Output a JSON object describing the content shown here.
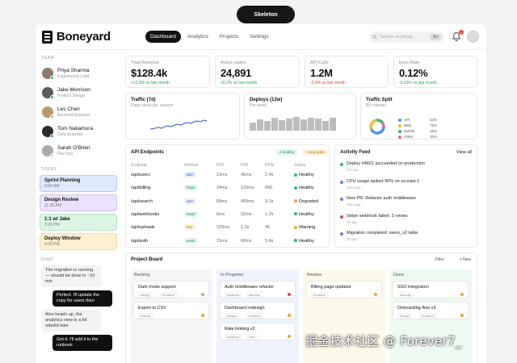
{
  "pill": {
    "label": "Skeleton"
  },
  "header": {
    "logo": "Boneyard",
    "nav": [
      "Dashboard",
      "Analytics",
      "Projects",
      "Settings"
    ],
    "search_placeholder": "Search anything...",
    "search_kbd": "⌘K",
    "notif_count": "3"
  },
  "sidebar": {
    "team_header": "TEAM",
    "team": [
      {
        "name": "Priya Sharma",
        "role": "Engineering Lead",
        "avatar": "#8c7a6b",
        "status": "#2eb872"
      },
      {
        "name": "Jake Morrison",
        "role": "Product Design",
        "avatar": "#5a5a5a",
        "status": "#2eb872"
      },
      {
        "name": "Les Chen",
        "role": "Backend Engineer",
        "avatar": "#b89a70",
        "status": "#e8a33a"
      },
      {
        "name": "Tom Nakamura",
        "role": "Data Scientist",
        "avatar": "#2c2c2c",
        "status": "#2eb872"
      },
      {
        "name": "Sarah O'Brien",
        "role": "Dev Ops",
        "avatar": "#aaaaaa",
        "status": "#cccccc"
      }
    ],
    "today_header": "TODAY",
    "events": [
      {
        "title": "Sprint Planning",
        "time": "9:00 AM",
        "bg": "#dfe9ff",
        "border": "#b9cdf5"
      },
      {
        "title": "Design Review",
        "time": "11:30 AM",
        "bg": "#ece2fb",
        "border": "#d2c0f0"
      },
      {
        "title": "1:1 w/ Jake",
        "time": "2:00 PM",
        "bg": "#ddf5e4",
        "border": "#b9e5c5"
      },
      {
        "title": "Deploy Window",
        "time": "4:00 PM",
        "bg": "#fdf0cf",
        "border": "#f2dc9e"
      }
    ],
    "chat_header": "CHAT",
    "chat": [
      {
        "dir": "in",
        "text": "The migration is running — should be done in ~10 min"
      },
      {
        "dir": "out",
        "text": "Perfect. I'll update the copy for users then"
      },
      {
        "dir": "in",
        "text": "Also heads up, the analytics view is a bit rebuild later"
      },
      {
        "dir": "out",
        "text": "Got it. I'll add it to the runbook"
      }
    ]
  },
  "kpis": [
    {
      "label": "Total Revenue",
      "value": "$128.4k",
      "delta": "+12.5% vs last month",
      "color": "#1e9e5a"
    },
    {
      "label": "Active Users",
      "value": "24,891",
      "delta": "+8.2% vs last month",
      "color": "#1e9e5a"
    },
    {
      "label": "API Calls",
      "value": "1.2M",
      "delta": "-2.4% vs last month",
      "color": "#d94242"
    },
    {
      "label": "Error Rate",
      "value": "0.12%",
      "delta": "-0.03% vs last month",
      "color": "#1e9e5a"
    }
  ],
  "minis": [
    {
      "title": "Traffic (7d)",
      "sub": "Page views per session"
    },
    {
      "title": "Deploys (12w)",
      "sub": "Per week"
    },
    {
      "title": "Traffic Split",
      "sub": "By channel"
    }
  ],
  "split": [
    {
      "label": "API",
      "value": "43%",
      "color": "#4c8ff5"
    },
    {
      "label": "Web",
      "value": "76%",
      "color": "#f0b93a"
    },
    {
      "label": "Mobile",
      "value": "15%",
      "color": "#2eb872"
    },
    {
      "label": "Other",
      "value": "10%",
      "color": "#e76a9c"
    }
  ],
  "api": {
    "title": "API Endpoints",
    "tags": [
      "4 healthy",
      "1 degraded"
    ],
    "headers": [
      "Endpoint",
      "Method",
      "P50",
      "P99",
      "RPM",
      "Status"
    ],
    "rows": [
      [
        "/api/users",
        "GET",
        "12ms",
        "45ms",
        "2.4k",
        "Healthy"
      ],
      [
        "/api/billing",
        "POST",
        "34ms",
        "120ms",
        "890",
        "Healthy"
      ],
      [
        "/api/search",
        "GET",
        "89ms",
        "450ms",
        "3.1k",
        "Degraded"
      ],
      [
        "/api/webhooks",
        "POST",
        "8ms",
        "32ms",
        "1.2k",
        "Healthy"
      ],
      [
        "/api/uploads",
        "PUT",
        "320ms",
        "1.2s",
        "45",
        "Warning"
      ],
      [
        "/api/auth",
        "POST",
        "15ms",
        "60ms",
        "5.6k",
        "Healthy"
      ]
    ]
  },
  "activity": {
    "title": "Activity Feed",
    "link": "View all",
    "items": [
      {
        "text": "Deploy #4821 succeeded on production",
        "time": "2m ago",
        "color": "#2eb872"
      },
      {
        "text": "CPU usage spiked 90% on us-east-1",
        "time": "15m ago",
        "color": "#4c8ff5"
      },
      {
        "text": "New PR: Refactor auth middleware",
        "time": "32m ago",
        "color": "#8c6cf0"
      },
      {
        "text": "Stripe webhook failed: 3 retries",
        "time": "1h ago",
        "color": "#d94242"
      },
      {
        "text": "Migration completed: users_v2 table",
        "time": "2h ago",
        "color": "#8c6cf0"
      }
    ]
  },
  "board": {
    "title": "Project Board",
    "filter": "Filter",
    "new": "+ New",
    "columns": [
      {
        "name": "Backlog",
        "bg": "#f6f6f6",
        "cards": [
          {
            "title": "Dark mode support",
            "tags": "design",
            "tag2": "frontend",
            "dot": "#e8a33a"
          },
          {
            "title": "Export to CSV",
            "tags": "feature",
            "tag2": "",
            "dot": "#e8a33a"
          }
        ]
      },
      {
        "name": "In Progress",
        "bg": "#eef3fd",
        "cards": [
          {
            "title": "Auth middleware refactor",
            "tags": "backend",
            "tag2": "security",
            "dot": "#d94242"
          },
          {
            "title": "Dashboard redesign",
            "tags": "design",
            "tag2": "frontend",
            "dot": "#e8a33a"
          },
          {
            "title": "Rate limiting v2",
            "tags": "backend",
            "tag2": "infra",
            "dot": "#e8a33a"
          }
        ]
      },
      {
        "name": "Review",
        "bg": "#fdf9e9",
        "cards": [
          {
            "title": "Billing page updates",
            "tags": "frontend",
            "tag2": "",
            "dot": "#e8a33a"
          }
        ]
      },
      {
        "name": "Done",
        "bg": "#eef9f1",
        "cards": [
          {
            "title": "SSO integration",
            "tags": "security",
            "tag2": "",
            "dot": "#e8a33a"
          },
          {
            "title": "Onboarding flow v3",
            "tags": "design",
            "tag2": "frontend",
            "dot": "#e8a33a"
          }
        ]
      }
    ]
  },
  "watermark": "掘金技术社区 @ Forever7_"
}
